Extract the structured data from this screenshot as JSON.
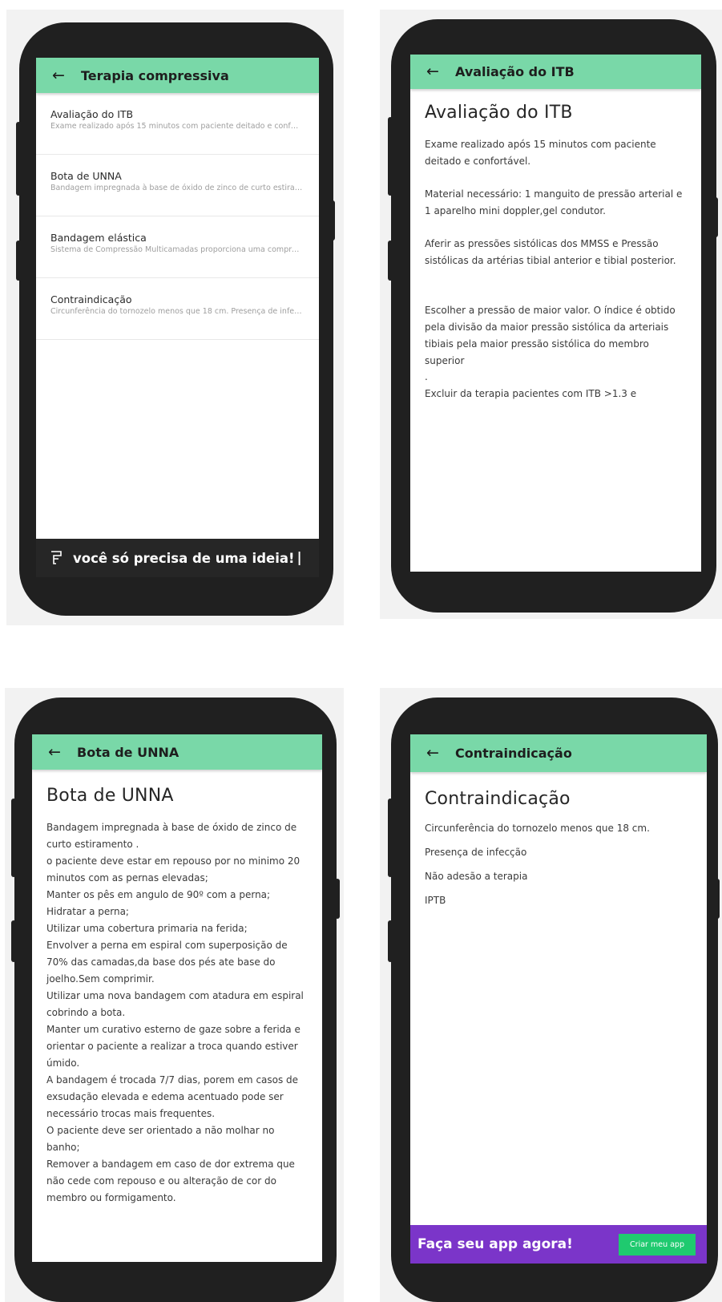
{
  "screen1": {
    "title": "Terapia compressiva",
    "items": [
      {
        "title": "Avaliação do ITB",
        "subtitle": "Exame realizado após 15 minutos com paciente deitado e confortável."
      },
      {
        "title": "Bota de UNNA",
        "subtitle": "Bandagem impregnada à base de óxido de zinco de curto estiramento ."
      },
      {
        "title": "Bandagem elástica",
        "subtitle": "Sistema de Compressão Multicamadas proporciona uma compressão eficaz"
      },
      {
        "title": "Contraindicação",
        "subtitle": "Circunferência do tornozelo menos que 18 cm. Presença de infecção"
      }
    ],
    "banner": {
      "text": "você só precisa de uma ideia!",
      "cursor": "|",
      "icon": "fabrica-logo-icon"
    }
  },
  "screen2": {
    "title": "Avaliação do ITB",
    "heading": "Avaliação do ITB",
    "paragraphs": [
      "Exame realizado após 15 minutos com paciente deitado e confortável.",
      "Material necessário: 1 manguito de pressão arterial e 1 aparelho mini doppler,gel condutor.",
      "Aferir as pressões sistólicas dos MMSS e Pressão sistólicas da artérias tibial anterior e tibial posterior.",
      "Escolher a pressão de maior valor. O índice é obtido pela divisão da maior pressão sistólica da arteriais tibiais pela maior pressão sistólica do membro superior",
      ".",
      "Excluir da terapia pacientes com ITB >1.3 e"
    ]
  },
  "screen3": {
    "title": "Bota de UNNA",
    "heading": "Bota de UNNA",
    "lines": [
      "Bandagem impregnada à base de óxido de zinco de curto estiramento .",
      "o paciente deve estar em repouso por no minimo 20 minutos com as pernas elevadas;",
      "Manter os pês em angulo de 90º com a perna;",
      "Hidratar a perna;",
      "Utilizar uma cobertura primaria na ferida;",
      "Envolver a perna em espiral com superposição de 70% das camadas,da base dos pés ate base do joelho.Sem comprimir.",
      "Utilizar uma nova bandagem com atadura em espiral cobrindo a bota.",
      "Manter um curativo esterno de gaze sobre a ferida e orientar o paciente a realizar a troca quando estiver úmido.",
      "A bandagem é trocada 7/7 dias, porem em casos de exsudação elevada e edema acentuado pode ser necessário trocas mais frequentes.",
      "O paciente deve ser orientado a não molhar no banho;",
      "Remover a bandagem em caso de dor extrema que não cede com repouso e ou alteração de cor do membro ou formigamento."
    ]
  },
  "screen4": {
    "title": "Contraindicação",
    "heading": "Contraindicação",
    "items": [
      "Circunferência do tornozelo menos que 18 cm.",
      "Presença de infecção",
      "Não adesão a terapia",
      "IPTB"
    ],
    "banner": {
      "text": "Faça seu app agora!",
      "button": "Criar meu app"
    }
  },
  "icons": {
    "back": "arrow-left-icon"
  },
  "colors": {
    "appbar": "#79d8a8",
    "phone": "#202020",
    "banner_dark": "#262626",
    "banner_purple": "#7b35c9",
    "cta_green": "#1fca6f"
  }
}
